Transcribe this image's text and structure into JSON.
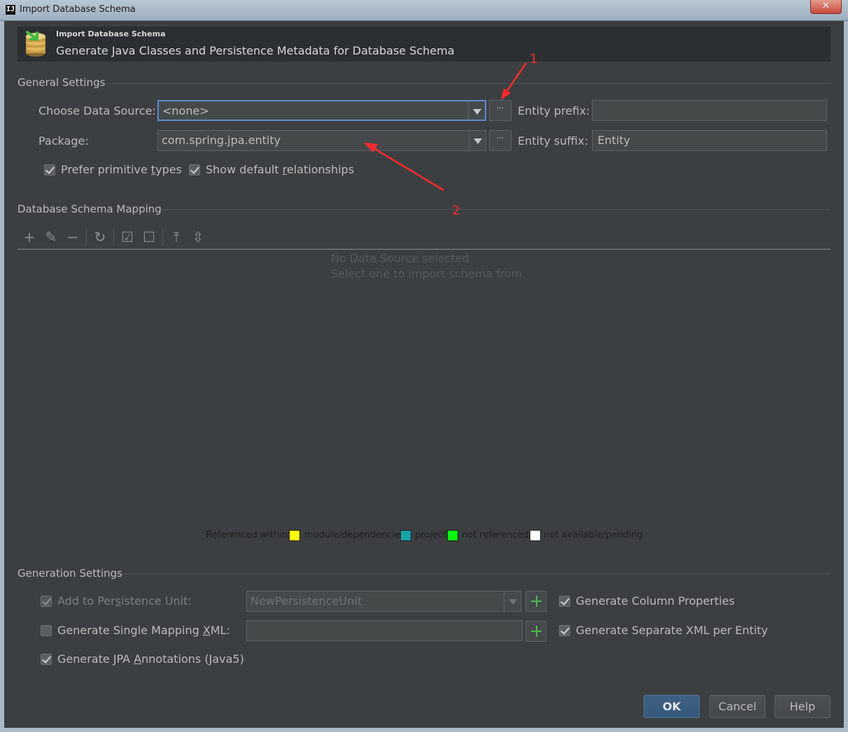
{
  "window": {
    "title": "Import Database Schema",
    "app_icon": "intellij-icon",
    "close_symbol": "✕"
  },
  "header": {
    "small_title": "Import Database Schema",
    "subtitle": "Generate Java Classes and Persistence Metadata for Database Schema",
    "icon": "database-import-icon"
  },
  "general": {
    "section_title": "General Settings",
    "data_source_label": "Choose Data Source:",
    "data_source_value": "<none>",
    "package_label": "Package:",
    "package_value": "com.spring.jpa.entity",
    "browse_symbol": "···",
    "entity_prefix_label": "Entity prefix:",
    "entity_prefix_value": "",
    "entity_suffix_label": "Entity suffix:",
    "entity_suffix_value": "Entity",
    "prefer_primitive": {
      "before": "Prefer primitive ",
      "mnemonic": "t",
      "after": "ypes",
      "checked": true
    },
    "show_default_rel": {
      "before": "Show default ",
      "mnemonic": "r",
      "after": "elationships",
      "checked": true
    }
  },
  "mapping": {
    "section_title": "Database Schema Mapping",
    "toolbar_icons": [
      "add-icon",
      "edit-icon",
      "remove-icon",
      "refresh-icon",
      "check-all-icon",
      "uncheck-all-icon",
      "expand-all-icon",
      "collapse-all-icon"
    ],
    "empty_line1": "No Data Source selected",
    "empty_line2": "Select one to import schema from.",
    "legend": {
      "prefix": "Referenced within:",
      "items": [
        {
          "label": "module/dependencies",
          "color": "#ffff00"
        },
        {
          "label": "project",
          "color": "#14a3a8"
        },
        {
          "label": "not referenced",
          "color": "#00ff00"
        },
        {
          "label": "not available/pending",
          "color": "#ffffff"
        }
      ]
    }
  },
  "generation": {
    "section_title": "Generation Settings",
    "add_to_pu": {
      "before": "Add to Per",
      "mnemonic": "s",
      "after": "istence Unit:",
      "checked": true,
      "disabled": true
    },
    "pu_value": "NewPersistenceUnit",
    "single_xml": {
      "before": "Generate Single Mapping ",
      "mnemonic": "X",
      "after": "ML:",
      "checked": false
    },
    "single_xml_value": "",
    "jpa_annotations": {
      "before": "Generate JPA ",
      "mnemonic": "A",
      "after": "nnotations (Java5)",
      "checked": true
    },
    "column_props": {
      "label": "Generate Column Properties",
      "checked": true
    },
    "separate_xml": {
      "label": "Generate Separate XML per Entity",
      "checked": true
    }
  },
  "buttons": {
    "ok": "OK",
    "cancel": "Cancel",
    "help": "Help"
  },
  "annotations": {
    "arrow1": "1",
    "arrow2": "2",
    "color": "#ff2b2b"
  }
}
